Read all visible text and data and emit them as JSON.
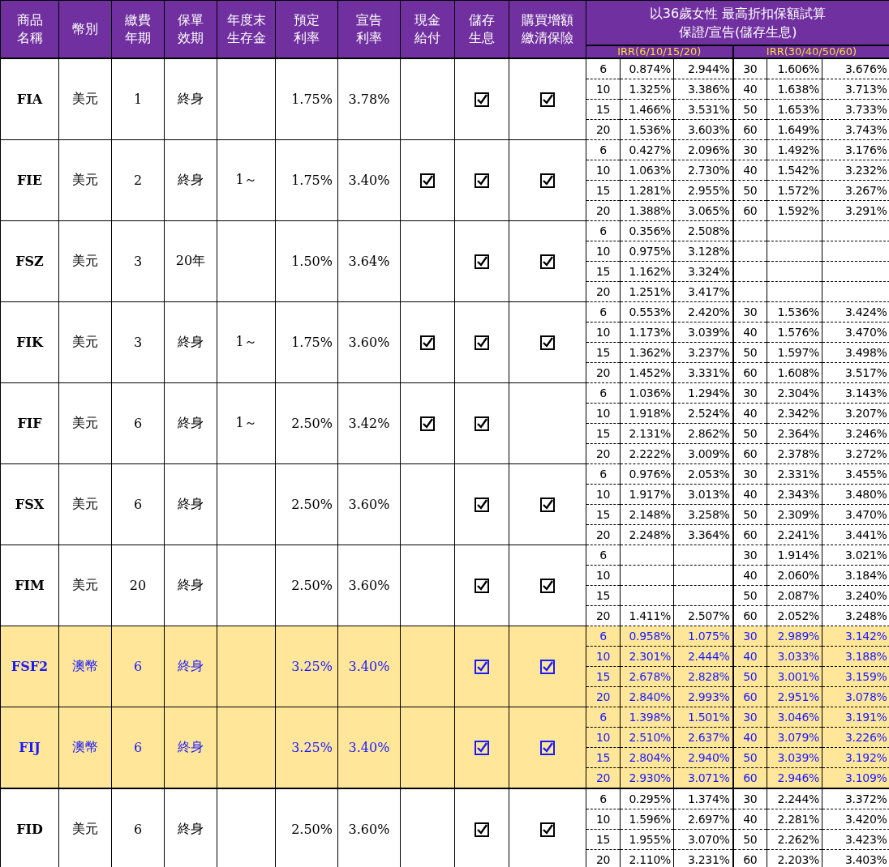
{
  "header": {
    "columns": [
      "商品名稱",
      "幣別",
      "繳費年期",
      "保單效期",
      "年度末生存金",
      "預定利率",
      "宣告利率",
      "現金給付",
      "儲存生息",
      "購買增額繳清保險"
    ],
    "irr_title": "以36歲女性  最高折扣保額試算",
    "irr_subtitle": "保證/宣告(儲存生息)",
    "irr_groups": [
      "IRR(6/10/15/20)",
      "IRR(30/40/50/60)"
    ]
  },
  "products": [
    {
      "code": "FIA",
      "currency": "美元",
      "pay_term": "1",
      "validity": "終身",
      "predicted_rate": "1.75%",
      "declared_rate": "3.78%",
      "cash_payment": false,
      "savings_interest": true,
      "paid_up": true,
      "highlighted": false,
      "irr": [
        {
          "term": "6",
          "guaranteed": "0.874%",
          "declared": "2.944%",
          "term_b": "30",
          "guaranteed_b": "1.606%",
          "declared_b": "3.676%"
        },
        {
          "term": "10",
          "guaranteed": "1.325%",
          "declared": "3.386%",
          "term_b": "40",
          "guaranteed_b": "1.638%",
          "declared_b": "3.713%"
        },
        {
          "term": "15",
          "guaranteed": "1.466%",
          "declared": "3.531%",
          "term_b": "50",
          "guaranteed_b": "1.653%",
          "declared_b": "3.733%"
        },
        {
          "term": "20",
          "guaranteed": "1.536%",
          "declared": "3.603%",
          "term_b": "60",
          "guaranteed_b": "1.649%",
          "declared_b": "3.743%"
        }
      ]
    },
    {
      "code": "FIE",
      "currency": "美元",
      "pay_term": "2",
      "validity": "終身",
      "survival": "1～",
      "predicted_rate": "1.75%",
      "declared_rate": "3.40%",
      "cash_payment": true,
      "savings_interest": true,
      "paid_up": true,
      "highlighted": false,
      "irr": [
        {
          "term": "6",
          "guaranteed": "0.427%",
          "declared": "2.096%",
          "term_b": "30",
          "guaranteed_b": "1.492%",
          "declared_b": "3.176%"
        },
        {
          "term": "10",
          "guaranteed": "1.063%",
          "declared": "2.730%",
          "term_b": "40",
          "guaranteed_b": "1.542%",
          "declared_b": "3.232%"
        },
        {
          "term": "15",
          "guaranteed": "1.281%",
          "declared": "2.955%",
          "term_b": "50",
          "guaranteed_b": "1.572%",
          "declared_b": "3.267%"
        },
        {
          "term": "20",
          "guaranteed": "1.388%",
          "declared": "3.065%",
          "term_b": "60",
          "guaranteed_b": "1.592%",
          "declared_b": "3.291%"
        }
      ]
    },
    {
      "code": "FSZ",
      "currency": "美元",
      "pay_term": "3",
      "validity": "20年",
      "predicted_rate": "1.50%",
      "declared_rate": "3.64%",
      "cash_payment": false,
      "savings_interest": true,
      "paid_up": true,
      "highlighted": false,
      "irr": [
        {
          "term": "6",
          "guaranteed": "0.356%",
          "declared": "2.508%"
        },
        {
          "term": "10",
          "guaranteed": "0.975%",
          "declared": "3.128%"
        },
        {
          "term": "15",
          "guaranteed": "1.162%",
          "declared": "3.324%"
        },
        {
          "term": "20",
          "guaranteed": "1.251%",
          "declared": "3.417%"
        }
      ]
    },
    {
      "code": "FIK",
      "currency": "美元",
      "pay_term": "3",
      "validity": "終身",
      "survival": "1～",
      "predicted_rate": "1.75%",
      "declared_rate": "3.60%",
      "cash_payment": true,
      "savings_interest": true,
      "paid_up": true,
      "highlighted": false,
      "irr": [
        {
          "term": "6",
          "guaranteed": "0.553%",
          "declared": "2.420%",
          "term_b": "30",
          "guaranteed_b": "1.536%",
          "declared_b": "3.424%"
        },
        {
          "term": "10",
          "guaranteed": "1.173%",
          "declared": "3.039%",
          "term_b": "40",
          "guaranteed_b": "1.576%",
          "declared_b": "3.470%"
        },
        {
          "term": "15",
          "guaranteed": "1.362%",
          "declared": "3.237%",
          "term_b": "50",
          "guaranteed_b": "1.597%",
          "declared_b": "3.498%"
        },
        {
          "term": "20",
          "guaranteed": "1.452%",
          "declared": "3.331%",
          "term_b": "60",
          "guaranteed_b": "1.608%",
          "declared_b": "3.517%"
        }
      ]
    },
    {
      "code": "FIF",
      "currency": "美元",
      "pay_term": "6",
      "validity": "終身",
      "survival": "1～",
      "predicted_rate": "2.50%",
      "declared_rate": "3.42%",
      "cash_payment": true,
      "savings_interest": true,
      "paid_up": false,
      "highlighted": false,
      "irr": [
        {
          "term": "6",
          "guaranteed": "1.036%",
          "declared": "1.294%",
          "term_b": "30",
          "guaranteed_b": "2.304%",
          "declared_b": "3.143%"
        },
        {
          "term": "10",
          "guaranteed": "1.918%",
          "declared": "2.524%",
          "term_b": "40",
          "guaranteed_b": "2.342%",
          "declared_b": "3.207%"
        },
        {
          "term": "15",
          "guaranteed": "2.131%",
          "declared": "2.862%",
          "term_b": "50",
          "guaranteed_b": "2.364%",
          "declared_b": "3.246%"
        },
        {
          "term": "20",
          "guaranteed": "2.222%",
          "declared": "3.009%",
          "term_b": "60",
          "guaranteed_b": "2.378%",
          "declared_b": "3.272%"
        }
      ]
    },
    {
      "code": "FSX",
      "currency": "美元",
      "pay_term": "6",
      "validity": "終身",
      "predicted_rate": "2.50%",
      "declared_rate": "3.60%",
      "cash_payment": false,
      "savings_interest": true,
      "paid_up": true,
      "highlighted": false,
      "irr": [
        {
          "term": "6",
          "guaranteed": "0.976%",
          "declared": "2.053%",
          "term_b": "30",
          "guaranteed_b": "2.331%",
          "declared_b": "3.455%"
        },
        {
          "term": "10",
          "guaranteed": "1.917%",
          "declared": "3.013%",
          "term_b": "40",
          "guaranteed_b": "2.343%",
          "declared_b": "3.480%"
        },
        {
          "term": "15",
          "guaranteed": "2.148%",
          "declared": "3.258%",
          "term_b": "50",
          "guaranteed_b": "2.309%",
          "declared_b": "3.470%"
        },
        {
          "term": "20",
          "guaranteed": "2.248%",
          "declared": "3.364%",
          "term_b": "60",
          "guaranteed_b": "2.241%",
          "declared_b": "3.441%"
        }
      ]
    },
    {
      "code": "FIM",
      "currency": "美元",
      "pay_term": "20",
      "validity": "終身",
      "predicted_rate": "2.50%",
      "declared_rate": "3.60%",
      "cash_payment": false,
      "savings_interest": true,
      "paid_up": true,
      "highlighted": false,
      "irr": [
        {
          "term": "6",
          "term_b": "30",
          "guaranteed_b": "1.914%",
          "declared_b": "3.021%"
        },
        {
          "term": "10",
          "term_b": "40",
          "guaranteed_b": "2.060%",
          "declared_b": "3.184%"
        },
        {
          "term": "15",
          "term_b": "50",
          "guaranteed_b": "2.087%",
          "declared_b": "3.240%"
        },
        {
          "term": "20",
          "guaranteed": "1.411%",
          "declared": "2.507%",
          "term_b": "60",
          "guaranteed_b": "2.052%",
          "declared_b": "3.248%"
        }
      ]
    },
    {
      "code": "FSF2",
      "currency": "澳幣",
      "pay_term": "6",
      "validity": "終身",
      "predicted_rate": "3.25%",
      "declared_rate": "3.40%",
      "cash_payment": false,
      "savings_interest": true,
      "paid_up": true,
      "highlighted": true,
      "irr": [
        {
          "term": "6",
          "guaranteed": "0.958%",
          "declared": "1.075%",
          "term_b": "30",
          "guaranteed_b": "2.989%",
          "declared_b": "3.142%"
        },
        {
          "term": "10",
          "guaranteed": "2.301%",
          "declared": "2.444%",
          "term_b": "40",
          "guaranteed_b": "3.033%",
          "declared_b": "3.188%"
        },
        {
          "term": "15",
          "guaranteed": "2.678%",
          "declared": "2.828%",
          "term_b": "50",
          "guaranteed_b": "3.001%",
          "declared_b": "3.159%"
        },
        {
          "term": "20",
          "guaranteed": "2.840%",
          "declared": "2.993%",
          "term_b": "60",
          "guaranteed_b": "2.951%",
          "declared_b": "3.078%"
        }
      ]
    },
    {
      "code": "FIJ",
      "currency": "澳幣",
      "pay_term": "6",
      "validity": "終身",
      "predicted_rate": "3.25%",
      "declared_rate": "3.40%",
      "cash_payment": false,
      "savings_interest": true,
      "paid_up": true,
      "highlighted": true,
      "irr": [
        {
          "term": "6",
          "guaranteed": "1.398%",
          "declared": "1.501%",
          "term_b": "30",
          "guaranteed_b": "3.046%",
          "declared_b": "3.191%"
        },
        {
          "term": "10",
          "guaranteed": "2.510%",
          "declared": "2.637%",
          "term_b": "40",
          "guaranteed_b": "3.079%",
          "declared_b": "3.226%"
        },
        {
          "term": "15",
          "guaranteed": "2.804%",
          "declared": "2.940%",
          "term_b": "50",
          "guaranteed_b": "3.039%",
          "declared_b": "3.192%"
        },
        {
          "term": "20",
          "guaranteed": "2.930%",
          "declared": "3.071%",
          "term_b": "60",
          "guaranteed_b": "2.946%",
          "declared_b": "3.109%"
        }
      ]
    },
    {
      "code": "FID",
      "currency": "美元",
      "pay_term": "6",
      "validity": "終身",
      "predicted_rate": "2.50%",
      "declared_rate": "3.60%",
      "cash_payment": false,
      "savings_interest": true,
      "paid_up": true,
      "highlighted": false,
      "irr": [
        {
          "term": "6",
          "guaranteed": "0.295%",
          "declared": "1.374%",
          "term_b": "30",
          "guaranteed_b": "2.244%",
          "declared_b": "3.372%"
        },
        {
          "term": "10",
          "guaranteed": "1.596%",
          "declared": "2.697%",
          "term_b": "40",
          "guaranteed_b": "2.281%",
          "declared_b": "3.420%"
        },
        {
          "term": "15",
          "guaranteed": "1.955%",
          "declared": "3.070%",
          "term_b": "50",
          "guaranteed_b": "2.262%",
          "declared_b": "3.423%"
        },
        {
          "term": "20",
          "guaranteed": "2.110%",
          "declared": "3.231%",
          "term_b": "60",
          "guaranteed_b": "2.203%",
          "declared_b": "3.403%"
        }
      ]
    }
  ]
}
